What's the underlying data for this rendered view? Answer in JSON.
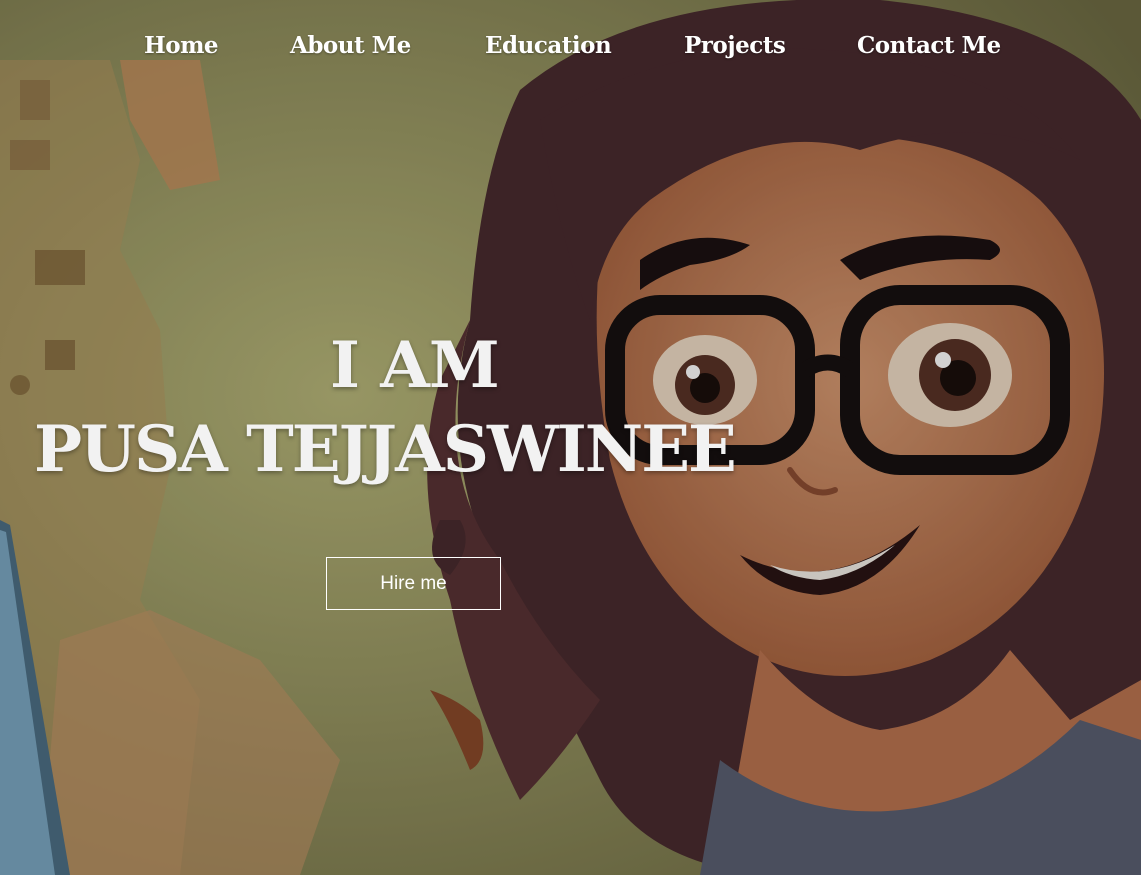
{
  "nav": {
    "items": [
      {
        "label": "Home"
      },
      {
        "label": "About Me"
      },
      {
        "label": "Education"
      },
      {
        "label": "Projects"
      },
      {
        "label": "Contact Me"
      }
    ]
  },
  "hero": {
    "line1": "I AM",
    "line2": "PUSA TEJJASWINEE",
    "button_label": "Hire me",
    "background_image": "cartoon-girl-with-glasses-illustration"
  },
  "colors": {
    "text": "#ffffff",
    "background_yellow": "#c8c488",
    "hair": "#4a2a2a",
    "skin": "#d08a62"
  }
}
